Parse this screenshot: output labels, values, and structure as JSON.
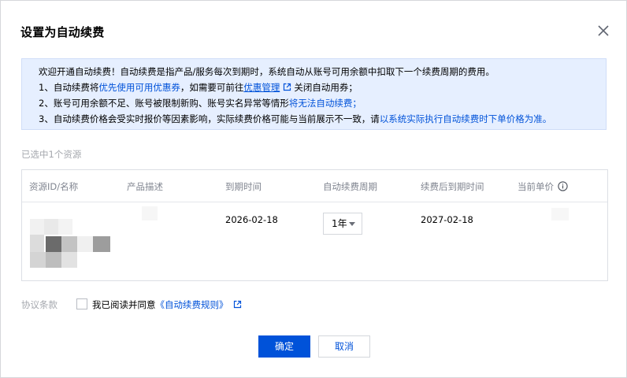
{
  "dialog": {
    "title": "设置为自动续费"
  },
  "notice": {
    "line1": "欢迎开通自动续费！自动续费是指产品/服务每次到期时，系统自动从账号可用余额中扣取下一个续费周期的费用。",
    "line2_prefix": "1、自动续费将",
    "line2_blue": "优先使用可用优惠券",
    "line2_mid": "，如需要可前往",
    "line2_link": "优惠管理",
    "line2_suffix": "关闭自动用券；",
    "line3_prefix": "2、账号可用余额不足、账号被限制新购、账号实名异常等情形",
    "line3_blue": "将无法自动续费；",
    "line4_prefix": "3、自动续费价格会受实时报价等因素影响，实际续费价格可能与当前展示不一致，请",
    "line4_blue": "以系统实际执行自动续费时下单价格为准。"
  },
  "selected_count": "已选中1个资源",
  "table": {
    "headers": [
      "资源ID/名称",
      "产品描述",
      "到期时间",
      "自动续费周期",
      "续费后到期时间",
      "当前单价"
    ],
    "row": {
      "expire_time": "2026-02-18",
      "period": "1年",
      "new_expire_time": "2027-02-18"
    }
  },
  "agreement": {
    "label": "协议条款",
    "text": "我已阅读并同意",
    "link": "《自动续费规则》",
    "checked": false
  },
  "buttons": {
    "confirm": "确定",
    "cancel": "取消"
  },
  "colors": {
    "primary": "#0052d9",
    "notice_bg": "#e6efff",
    "muted_text": "#a5a8ae",
    "header_text": "#808590"
  }
}
